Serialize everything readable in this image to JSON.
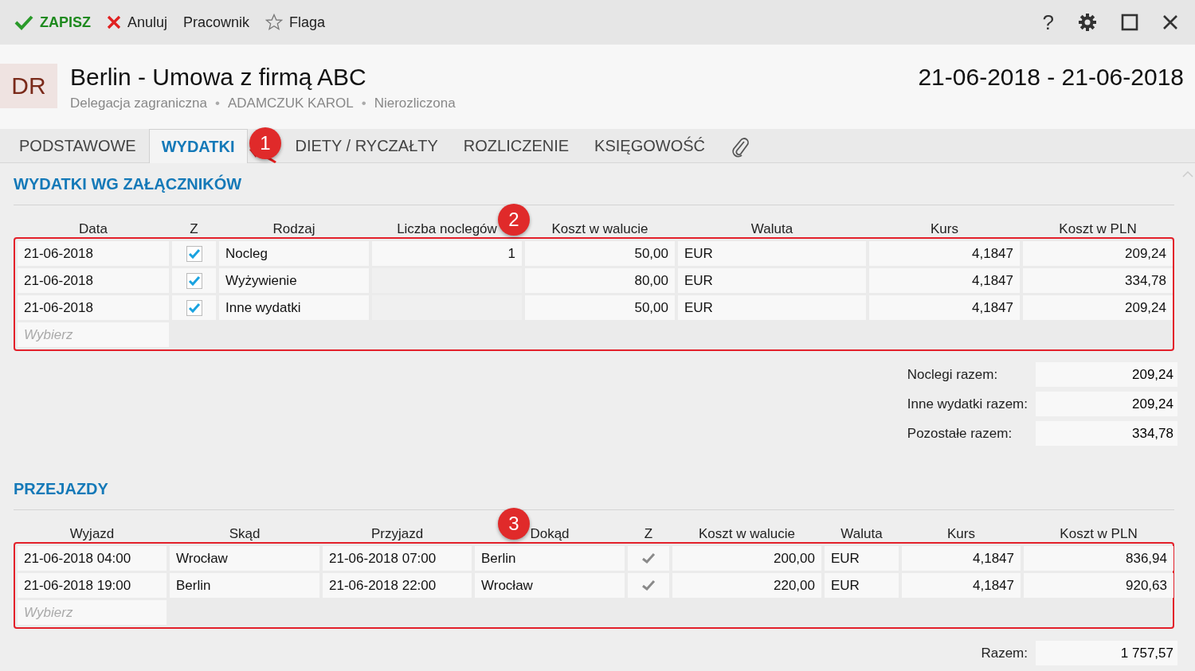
{
  "toolbar": {
    "left": [
      {
        "kind": "save",
        "label": "ZAPISZ"
      },
      {
        "kind": "cancel",
        "label": "Anuluj"
      },
      {
        "kind": "plain",
        "label": "Pracownik"
      },
      {
        "kind": "flag",
        "label": "Flaga"
      }
    ],
    "right": [
      {
        "kind": "help",
        "label": "?"
      },
      {
        "kind": "settings"
      },
      {
        "kind": "maximize"
      },
      {
        "kind": "close"
      }
    ]
  },
  "header": {
    "avatar": "DR",
    "title": "Berlin - Umowa z firmą ABC",
    "meta": [
      "Delegacja zagraniczna",
      "ADAMCZUK KAROL",
      "Nierozliczona"
    ],
    "separator": "•",
    "date_range": "21-06-2018 - 21-06-2018"
  },
  "tabs": [
    {
      "kind": "text",
      "label": "PODSTAWOWE",
      "selected": false
    },
    {
      "kind": "text",
      "label": "WYDATKI",
      "selected": true
    },
    {
      "kind": "text",
      "label": "DIETY / RYCZAŁTY",
      "selected": false
    },
    {
      "kind": "text",
      "label": "ROZLICZENIE",
      "selected": false
    },
    {
      "kind": "text",
      "label": "KSIĘGOWOŚĆ",
      "selected": false
    },
    {
      "kind": "attachment",
      "selected": false
    }
  ],
  "expenses": {
    "title": "WYDATKI WG ZAŁĄCZNIKÓW",
    "columns": [
      "Data",
      "Z",
      "Rodzaj",
      "Liczba noclegów",
      "Koszt w walucie",
      "Waluta",
      "Kurs",
      "Koszt w PLN"
    ],
    "rows": [
      {
        "date": "21-06-2018",
        "settled": true,
        "type": "Nocleg",
        "nights": "1",
        "amount": "50,00",
        "currency": "EUR",
        "rate": "4,1847",
        "pln": "209,24"
      },
      {
        "date": "21-06-2018",
        "settled": true,
        "type": "Wyżywienie",
        "amount": "80,00",
        "currency": "EUR",
        "rate": "4,1847",
        "pln": "334,78"
      },
      {
        "date": "21-06-2018",
        "settled": true,
        "type": "Inne wydatki",
        "amount": "50,00",
        "currency": "EUR",
        "rate": "4,1847",
        "pln": "209,24"
      }
    ],
    "picker_placeholder": "Wybierz"
  },
  "totals": [
    {
      "label": "Noclegi razem:",
      "value": "209,24"
    },
    {
      "label": "Inne wydatki razem:",
      "value": "209,24"
    },
    {
      "label": "Pozostałe razem:",
      "value": "334,78"
    }
  ],
  "trips": {
    "title": "PRZEJAZDY",
    "columns": [
      "Wyjazd",
      "Skąd",
      "Przyjazd",
      "Dokąd",
      "Z",
      "Koszt w walucie",
      "Waluta",
      "Kurs",
      "Koszt w PLN"
    ],
    "rows": [
      {
        "departure": "21-06-2018 04:00",
        "from": "Wrocław",
        "arrival": "21-06-2018 07:00",
        "to": "Berlin",
        "settled": true,
        "amount": "200,00",
        "currency": "EUR",
        "rate": "4,1847",
        "pln": "836,94"
      },
      {
        "departure": "21-06-2018 19:00",
        "from": "Berlin",
        "arrival": "21-06-2018 22:00",
        "to": "Wrocław",
        "settled": true,
        "amount": "220,00",
        "currency": "EUR",
        "rate": "4,1847",
        "pln": "920,63"
      }
    ],
    "picker_placeholder": "Wybierz"
  },
  "grand_total": {
    "label": "Razem:",
    "value": "1 757,57"
  },
  "callouts": [
    "1",
    "2",
    "3"
  ]
}
